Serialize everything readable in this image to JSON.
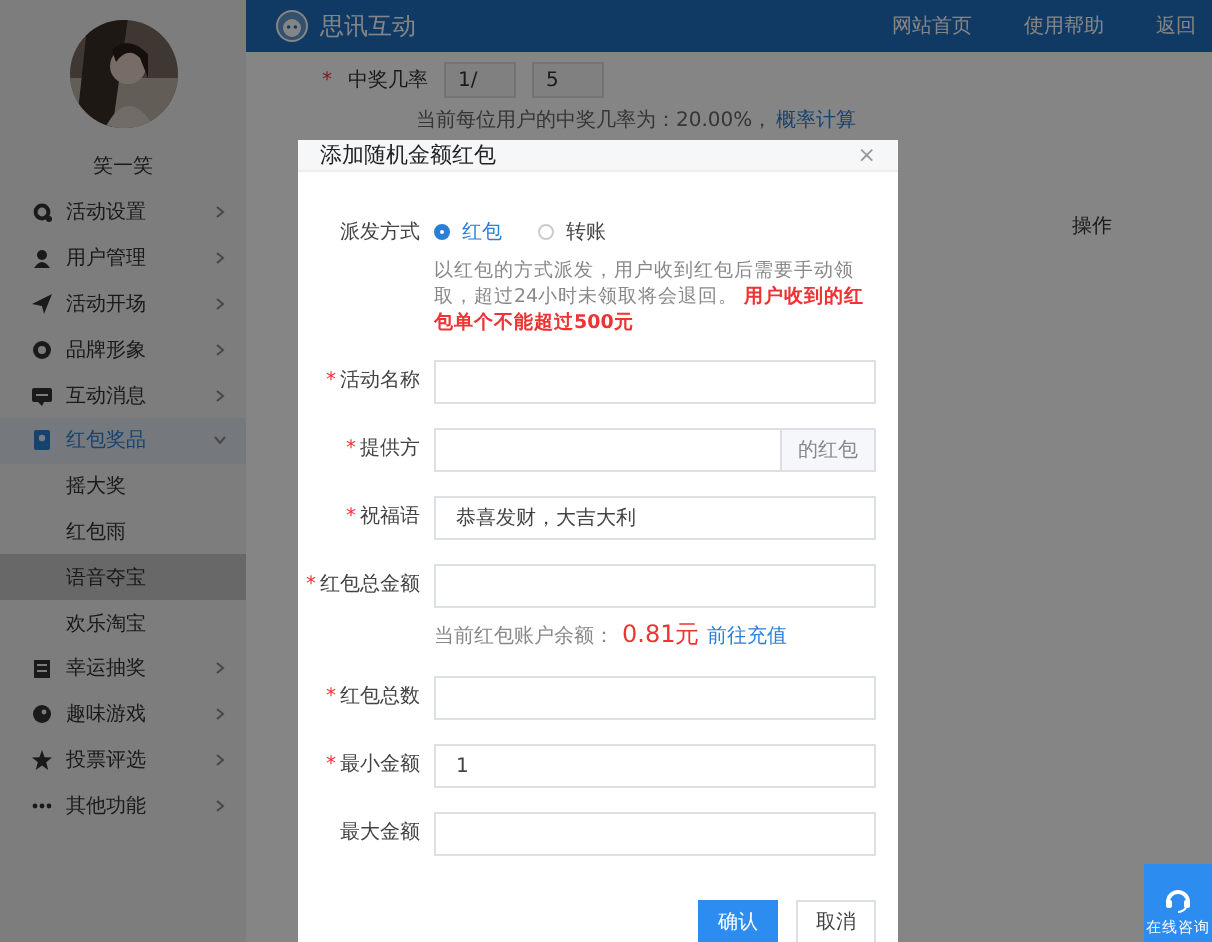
{
  "header": {
    "brand": "思讯互动",
    "nav": [
      "网站首页",
      "使用帮助",
      "返回"
    ]
  },
  "sidebar": {
    "user": "笑一笑",
    "items": [
      {
        "label": "活动设置",
        "selected": false,
        "expanded": false
      },
      {
        "label": "用户管理",
        "selected": false,
        "expanded": false
      },
      {
        "label": "活动开场",
        "selected": false,
        "expanded": false
      },
      {
        "label": "品牌形象",
        "selected": false,
        "expanded": false
      },
      {
        "label": "互动消息",
        "selected": false,
        "expanded": false
      },
      {
        "label": "红包奖品",
        "selected": true,
        "expanded": true,
        "children": [
          {
            "label": "摇大奖",
            "selected": false
          },
          {
            "label": "红包雨",
            "selected": false
          },
          {
            "label": "语音夺宝",
            "selected": true
          },
          {
            "label": "欢乐淘宝",
            "selected": false
          }
        ]
      },
      {
        "label": "幸运抽奖",
        "selected": false,
        "expanded": false
      },
      {
        "label": "趣味游戏",
        "selected": false,
        "expanded": false
      },
      {
        "label": "投票评选",
        "selected": false,
        "expanded": false
      },
      {
        "label": "其他功能",
        "selected": false,
        "expanded": false
      }
    ]
  },
  "background": {
    "mark": "*",
    "odds_label": "中奖几率",
    "odds_value_1": "1/",
    "odds_value_2": "5",
    "odds_note": "当前每位用户的中奖几率为：20.00%，",
    "odds_link": "概率计算",
    "column_header": "操作"
  },
  "dialog": {
    "title": "添加随机金额红包",
    "close": "×",
    "fields": [
      {
        "kind": "radio",
        "label": "派发方式",
        "options": [
          {
            "label": "红包",
            "selected": true
          },
          {
            "label": "转账",
            "selected": false
          }
        ],
        "note": "以红包的方式派发，用户收到红包后需要手动领取，超过24小时未领取将会退回。",
        "note_warning": "用户收到的红包单个不能超过500元"
      },
      {
        "kind": "text",
        "mark": "*",
        "label": "活动名称"
      },
      {
        "kind": "addon",
        "mark": "*",
        "label": "提供方",
        "addon": "的红包"
      },
      {
        "kind": "text",
        "mark": "*",
        "label": "祝福语",
        "value": "恭喜发财，大吉大利"
      },
      {
        "kind": "text",
        "mark": "*",
        "label": "红包总金额",
        "hint": "当前红包账户余额：",
        "hint_amount": "0.81元",
        "hint_link": "前往充值"
      },
      {
        "kind": "text",
        "mark": "*",
        "label": "红包总数"
      },
      {
        "kind": "text",
        "mark": "*",
        "label": "最小金额",
        "value": "1"
      },
      {
        "kind": "text",
        "label": "最大金额"
      }
    ],
    "buttons": [
      {
        "label": "确认",
        "primary": true
      },
      {
        "label": "取消",
        "primary": false
      }
    ]
  },
  "help_float": {
    "label": "在线咨询"
  }
}
